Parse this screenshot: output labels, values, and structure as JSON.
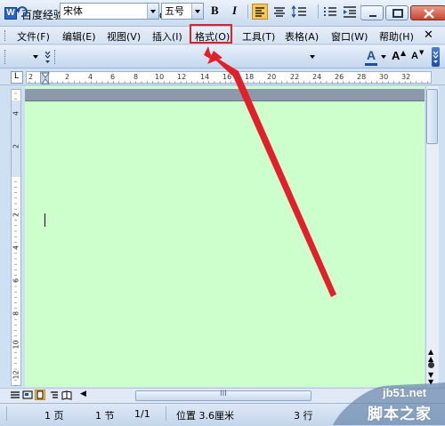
{
  "window": {
    "title": "百度经验.doc - Microsoft Word",
    "app_icon_letter": "W"
  },
  "menubar": {
    "items": [
      {
        "label": "文件(F)"
      },
      {
        "label": "编辑(E)"
      },
      {
        "label": "视图(V)"
      },
      {
        "label": "插入(I)"
      },
      {
        "label": "格式(O)",
        "highlighted": true
      },
      {
        "label": "工具(T)"
      },
      {
        "label": "表格(A)"
      },
      {
        "label": "窗口(W)"
      },
      {
        "label": "帮助(H)"
      }
    ],
    "close_glyph": "✕"
  },
  "toolbar": {
    "font_name": "宋体",
    "font_size": "五号",
    "bold_glyph": "B",
    "italic_glyph": "I",
    "font_color_glyph": "A",
    "grow_font_glyph": "A",
    "shrink_font_glyph": "A"
  },
  "ruler": {
    "corner_glyph": "L",
    "numbers": [
      "2",
      "2",
      "4",
      "6",
      "8",
      "10",
      "12",
      "14",
      "16",
      "18",
      "20",
      "22",
      "24",
      "26",
      "28",
      "30",
      "32"
    ],
    "vertical_numbers": [
      "4",
      "2",
      "2",
      "4",
      "6",
      "8",
      "10",
      "12"
    ]
  },
  "scrollbar": {
    "h_thumb_grip": "III"
  },
  "statusbar": {
    "page": "1 页",
    "section": "1 节",
    "page_of": "1/1",
    "position": "位置 3.6厘米",
    "line": "3 行"
  },
  "watermark": {
    "line1": "jb51.net",
    "line2": "脚本之家"
  },
  "colors": {
    "document_background": "#ccffcc",
    "annotation_red": "#e0202a"
  }
}
